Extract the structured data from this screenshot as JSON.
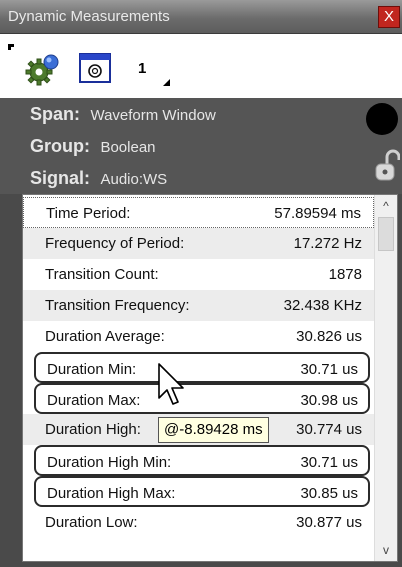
{
  "window": {
    "title": "Dynamic Measurements",
    "close_label": "X"
  },
  "toolbar": {
    "gear_icon": "gear-icon",
    "window_icon": "waveform-window-icon",
    "count_label": "1"
  },
  "info": {
    "span_label": "Span:",
    "span_value": "Waveform Window",
    "group_label": "Group:",
    "group_value": "Boolean",
    "signal_label": "Signal:",
    "signal_value": "Audio:WS",
    "status_icon": "status-dot-icon",
    "lock_icon": "unlocked-padlock-icon"
  },
  "measurements": [
    {
      "label": "Time Period:",
      "value": "57.89594 ms"
    },
    {
      "label": "Frequency of Period:",
      "value": "17.272 Hz"
    },
    {
      "label": "Transition Count:",
      "value": "1878"
    },
    {
      "label": "Transition Frequency:",
      "value": "32.438 KHz"
    },
    {
      "label": "Duration Average:",
      "value": "30.826 us"
    },
    {
      "label": "Duration Min:",
      "value": "30.71 us"
    },
    {
      "label": "Duration Max:",
      "value": "30.98 us"
    },
    {
      "label": "Duration High:",
      "value": "30.774 us"
    },
    {
      "label": "Duration High Min:",
      "value": "30.71 us"
    },
    {
      "label": "Duration High Max:",
      "value": "30.85 us"
    },
    {
      "label": "Duration Low:",
      "value": "30.877 us"
    }
  ],
  "tooltip": {
    "text": "@-8.89428 ms"
  },
  "scrollbar": {
    "up_arrow": "^",
    "down_arrow": "v"
  },
  "colors": {
    "close_button": "#c1261f",
    "panel_background": "#555555",
    "tooltip_background": "#ffffe1"
  }
}
